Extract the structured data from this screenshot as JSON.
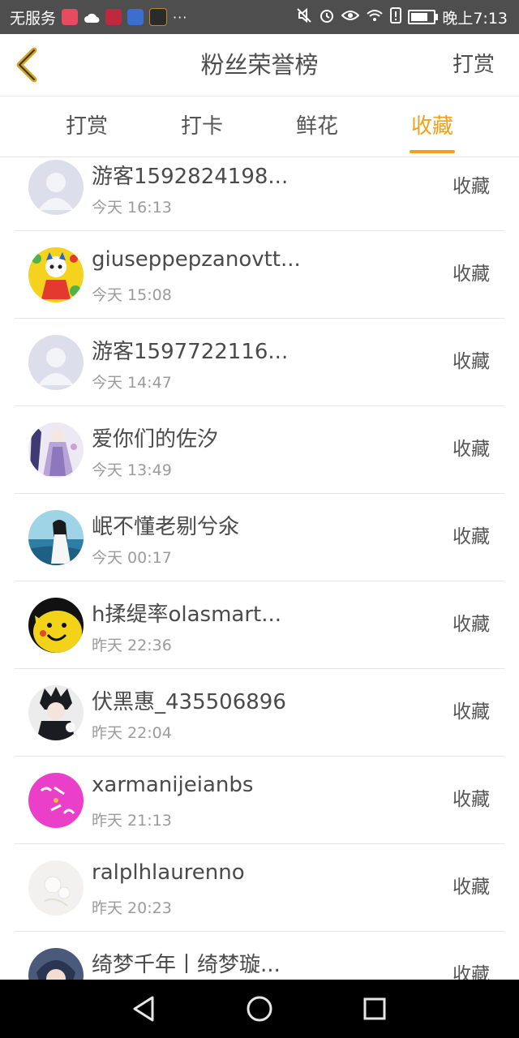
{
  "status_bar": {
    "carrier": "无服务",
    "more": "···",
    "time": "晚上7:13"
  },
  "header": {
    "title": "粉丝荣誉榜",
    "action": "打赏"
  },
  "tabs": [
    {
      "label": "打赏",
      "active": false
    },
    {
      "label": "打卡",
      "active": false
    },
    {
      "label": "鲜花",
      "active": false
    },
    {
      "label": "收藏",
      "active": true
    }
  ],
  "accent_color": "#f0a11c",
  "rows": [
    {
      "name": "游客1592824198...",
      "time": "今天 16:13",
      "action": "收藏"
    },
    {
      "name": "giuseppepzanovtt...",
      "time": "今天 15:08",
      "action": "收藏"
    },
    {
      "name": "游客1597722116...",
      "time": "今天 14:47",
      "action": "收藏"
    },
    {
      "name": "爱你们的佐汐",
      "time": "今天 13:49",
      "action": "收藏"
    },
    {
      "name": "岷不懂老剔兮氽",
      "time": "今天 00:17",
      "action": "收藏"
    },
    {
      "name": "h揉缇率olasmart...",
      "time": "昨天 22:36",
      "action": "收藏"
    },
    {
      "name": "伏黑惠_435506896",
      "time": "昨天 22:04",
      "action": "收藏"
    },
    {
      "name": "xarmanijeianbs",
      "time": "昨天 21:13",
      "action": "收藏"
    },
    {
      "name": "ralplhlaurenno",
      "time": "昨天 20:23",
      "action": "收藏"
    },
    {
      "name": "绮梦千年丨绮梦璇...",
      "time": "",
      "action": "收藏"
    }
  ],
  "avatars": [
    {
      "icon": "default-user-icon",
      "bg": "#dcdfeb"
    },
    {
      "icon": "cartoon-cat-avatar",
      "bg": "#f4d21d"
    },
    {
      "icon": "default-user-icon",
      "bg": "#dcdfeb"
    },
    {
      "icon": "girl-dress-avatar",
      "bg": "#e9e4f2"
    },
    {
      "icon": "girl-seaside-avatar",
      "bg": "#3f8fb0"
    },
    {
      "icon": "yellow-pikachu-avatar",
      "bg": "#f2d31a"
    },
    {
      "icon": "anime-boy-avatar",
      "bg": "#e8e8e8"
    },
    {
      "icon": "pink-text-avatar",
      "bg": "#ea3fc9"
    },
    {
      "icon": "white-flower-avatar",
      "bg": "#f3f1ef"
    },
    {
      "icon": "anime-character-avatar",
      "bg": "#4b5a7a"
    }
  ]
}
